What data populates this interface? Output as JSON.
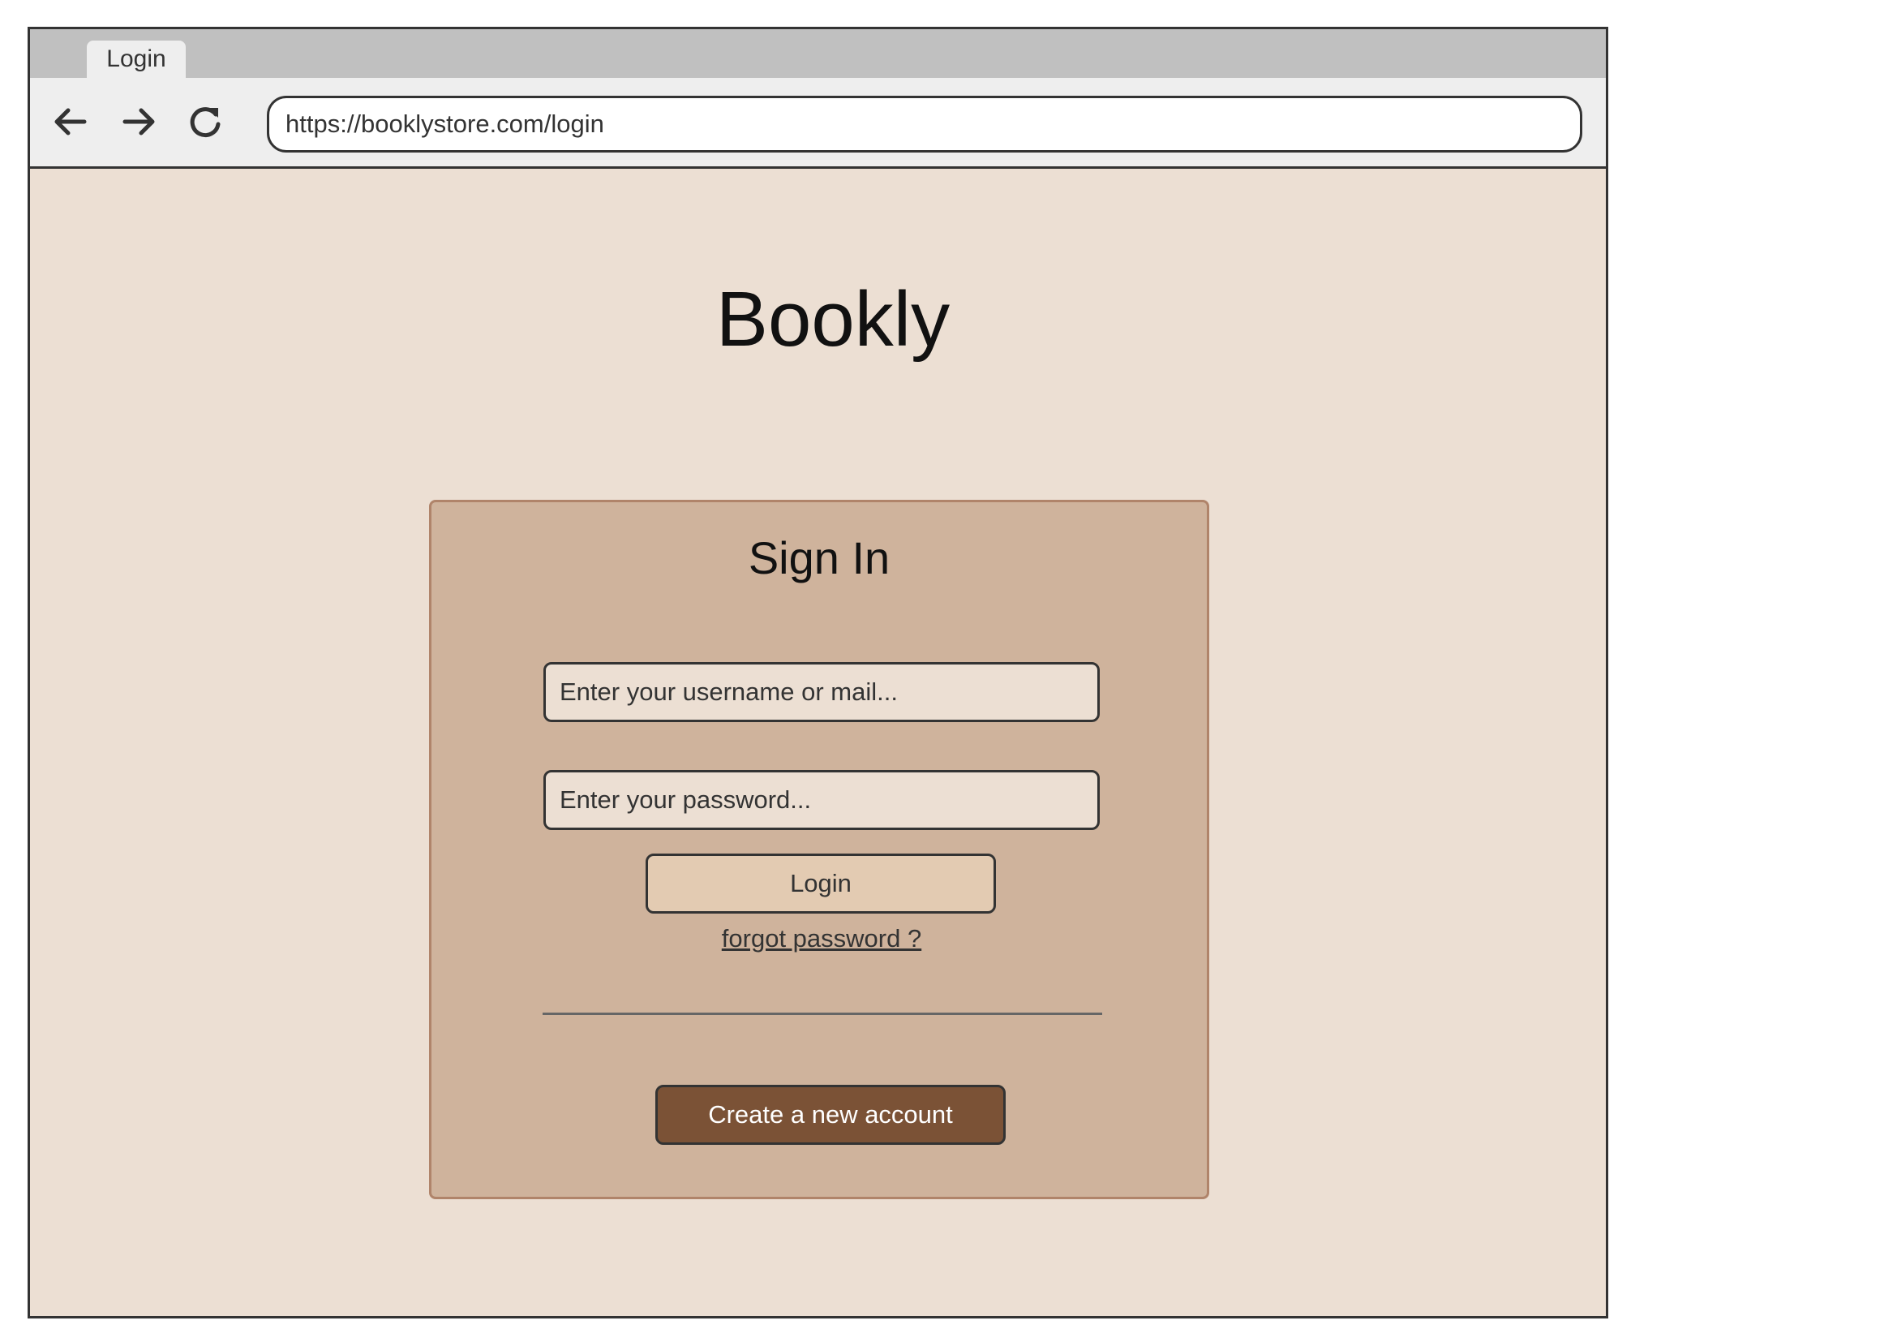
{
  "browser": {
    "tab_title": "Login",
    "url": "https://booklystore.com/login",
    "nav_icons": [
      "back-arrow-icon",
      "forward-arrow-icon",
      "reload-icon"
    ]
  },
  "page": {
    "title": "Bookly"
  },
  "signin": {
    "heading": "Sign In",
    "username_placeholder": "Enter your username or mail...",
    "password_placeholder": "Enter your password...",
    "login_label": "Login",
    "forgot_label": "forgot password ?",
    "create_account_label": "Create a new account"
  },
  "colors": {
    "page_background": "#ecdfd3",
    "card_background": "#cfb39c",
    "card_border": "#b0846a",
    "login_button": "#e3cbb2",
    "create_button": "#7b5236"
  }
}
